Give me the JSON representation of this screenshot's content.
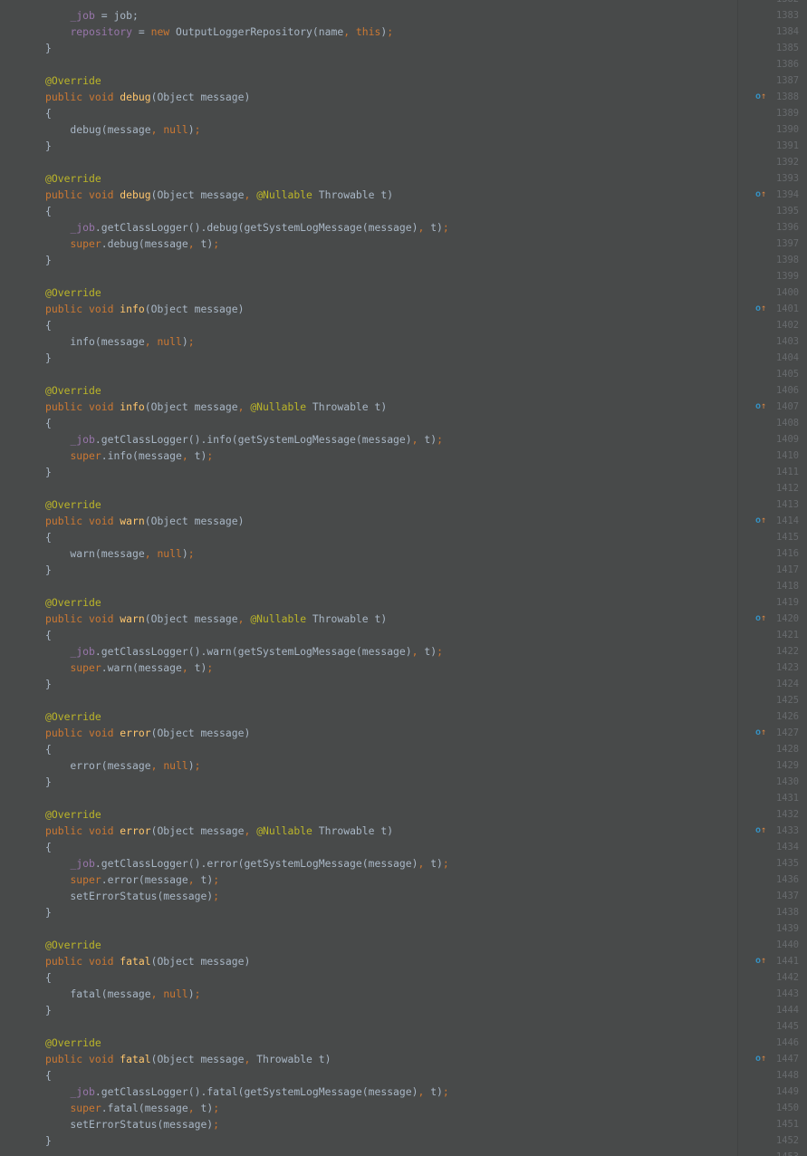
{
  "editor": {
    "first_line": 1382,
    "code_lines": [
      [],
      [
        {
          "t": "    ",
          "c": "pl"
        },
        {
          "t": "_job",
          "c": "fld"
        },
        {
          "t": " = job;",
          "c": "pl"
        }
      ],
      [
        {
          "t": "    ",
          "c": "pl"
        },
        {
          "t": "repository",
          "c": "fld"
        },
        {
          "t": " = ",
          "c": "pl"
        },
        {
          "t": "new",
          "c": "kw"
        },
        {
          "t": " OutputLoggerRepository(name",
          "c": "pl"
        },
        {
          "t": ", ",
          "c": "kw"
        },
        {
          "t": "this",
          "c": "kw"
        },
        {
          "t": ")",
          "c": "pl"
        },
        {
          "t": ";",
          "c": "kw"
        }
      ],
      [
        {
          "t": "}",
          "c": "pl"
        }
      ],
      [],
      [
        {
          "t": "@Override",
          "c": "ann"
        }
      ],
      [
        {
          "t": "public void ",
          "c": "kw"
        },
        {
          "t": "debug",
          "c": "fn"
        },
        {
          "t": "(Object message)",
          "c": "pl"
        }
      ],
      [
        {
          "t": "{",
          "c": "pl"
        }
      ],
      [
        {
          "t": "    debug(message",
          "c": "pl"
        },
        {
          "t": ", ",
          "c": "kw"
        },
        {
          "t": "null",
          "c": "kw"
        },
        {
          "t": ")",
          "c": "pl"
        },
        {
          "t": ";",
          "c": "kw"
        }
      ],
      [
        {
          "t": "}",
          "c": "pl"
        }
      ],
      [],
      [
        {
          "t": "@Override",
          "c": "ann"
        }
      ],
      [
        {
          "t": "public void ",
          "c": "kw"
        },
        {
          "t": "debug",
          "c": "fn"
        },
        {
          "t": "(Object message",
          "c": "pl"
        },
        {
          "t": ", ",
          "c": "kw"
        },
        {
          "t": "@Nullable",
          "c": "ann"
        },
        {
          "t": " Throwable t)",
          "c": "pl"
        }
      ],
      [
        {
          "t": "{",
          "c": "pl"
        }
      ],
      [
        {
          "t": "    ",
          "c": "pl"
        },
        {
          "t": "_job",
          "c": "fld"
        },
        {
          "t": ".getClassLogger().debug(getSystemLogMessage(message)",
          "c": "pl"
        },
        {
          "t": ", ",
          "c": "kw"
        },
        {
          "t": "t)",
          "c": "pl"
        },
        {
          "t": ";",
          "c": "kw"
        }
      ],
      [
        {
          "t": "    ",
          "c": "pl"
        },
        {
          "t": "super",
          "c": "kw"
        },
        {
          "t": ".debug(message",
          "c": "pl"
        },
        {
          "t": ", ",
          "c": "kw"
        },
        {
          "t": "t)",
          "c": "pl"
        },
        {
          "t": ";",
          "c": "kw"
        }
      ],
      [
        {
          "t": "}",
          "c": "pl"
        }
      ],
      [],
      [
        {
          "t": "@Override",
          "c": "ann"
        }
      ],
      [
        {
          "t": "public void ",
          "c": "kw"
        },
        {
          "t": "info",
          "c": "fn"
        },
        {
          "t": "(Object message)",
          "c": "pl"
        }
      ],
      [
        {
          "t": "{",
          "c": "pl"
        }
      ],
      [
        {
          "t": "    info(message",
          "c": "pl"
        },
        {
          "t": ", ",
          "c": "kw"
        },
        {
          "t": "null",
          "c": "kw"
        },
        {
          "t": ")",
          "c": "pl"
        },
        {
          "t": ";",
          "c": "kw"
        }
      ],
      [
        {
          "t": "}",
          "c": "pl"
        }
      ],
      [],
      [
        {
          "t": "@Override",
          "c": "ann"
        }
      ],
      [
        {
          "t": "public void ",
          "c": "kw"
        },
        {
          "t": "info",
          "c": "fn"
        },
        {
          "t": "(Object message",
          "c": "pl"
        },
        {
          "t": ", ",
          "c": "kw"
        },
        {
          "t": "@Nullable",
          "c": "ann"
        },
        {
          "t": " Throwable t)",
          "c": "pl"
        }
      ],
      [
        {
          "t": "{",
          "c": "pl"
        }
      ],
      [
        {
          "t": "    ",
          "c": "pl"
        },
        {
          "t": "_job",
          "c": "fld"
        },
        {
          "t": ".getClassLogger().info(getSystemLogMessage(message)",
          "c": "pl"
        },
        {
          "t": ", ",
          "c": "kw"
        },
        {
          "t": "t)",
          "c": "pl"
        },
        {
          "t": ";",
          "c": "kw"
        }
      ],
      [
        {
          "t": "    ",
          "c": "pl"
        },
        {
          "t": "super",
          "c": "kw"
        },
        {
          "t": ".info(message",
          "c": "pl"
        },
        {
          "t": ", ",
          "c": "kw"
        },
        {
          "t": "t)",
          "c": "pl"
        },
        {
          "t": ";",
          "c": "kw"
        }
      ],
      [
        {
          "t": "}",
          "c": "pl"
        }
      ],
      [],
      [
        {
          "t": "@Override",
          "c": "ann"
        }
      ],
      [
        {
          "t": "public void ",
          "c": "kw"
        },
        {
          "t": "warn",
          "c": "fn"
        },
        {
          "t": "(Object message)",
          "c": "pl"
        }
      ],
      [
        {
          "t": "{",
          "c": "pl"
        }
      ],
      [
        {
          "t": "    warn(message",
          "c": "pl"
        },
        {
          "t": ", ",
          "c": "kw"
        },
        {
          "t": "null",
          "c": "kw"
        },
        {
          "t": ")",
          "c": "pl"
        },
        {
          "t": ";",
          "c": "kw"
        }
      ],
      [
        {
          "t": "}",
          "c": "pl"
        }
      ],
      [],
      [
        {
          "t": "@Override",
          "c": "ann"
        }
      ],
      [
        {
          "t": "public void ",
          "c": "kw"
        },
        {
          "t": "warn",
          "c": "fn"
        },
        {
          "t": "(Object message",
          "c": "pl"
        },
        {
          "t": ", ",
          "c": "kw"
        },
        {
          "t": "@Nullable",
          "c": "ann"
        },
        {
          "t": " Throwable t)",
          "c": "pl"
        }
      ],
      [
        {
          "t": "{",
          "c": "pl"
        }
      ],
      [
        {
          "t": "    ",
          "c": "pl"
        },
        {
          "t": "_job",
          "c": "fld"
        },
        {
          "t": ".getClassLogger().warn(getSystemLogMessage(message)",
          "c": "pl"
        },
        {
          "t": ", ",
          "c": "kw"
        },
        {
          "t": "t)",
          "c": "pl"
        },
        {
          "t": ";",
          "c": "kw"
        }
      ],
      [
        {
          "t": "    ",
          "c": "pl"
        },
        {
          "t": "super",
          "c": "kw"
        },
        {
          "t": ".warn(message",
          "c": "pl"
        },
        {
          "t": ", ",
          "c": "kw"
        },
        {
          "t": "t)",
          "c": "pl"
        },
        {
          "t": ";",
          "c": "kw"
        }
      ],
      [
        {
          "t": "}",
          "c": "pl"
        }
      ],
      [],
      [
        {
          "t": "@Override",
          "c": "ann"
        }
      ],
      [
        {
          "t": "public void ",
          "c": "kw"
        },
        {
          "t": "error",
          "c": "fn"
        },
        {
          "t": "(Object message)",
          "c": "pl"
        }
      ],
      [
        {
          "t": "{",
          "c": "pl"
        }
      ],
      [
        {
          "t": "    error(message",
          "c": "pl"
        },
        {
          "t": ", ",
          "c": "kw"
        },
        {
          "t": "null",
          "c": "kw"
        },
        {
          "t": ")",
          "c": "pl"
        },
        {
          "t": ";",
          "c": "kw"
        }
      ],
      [
        {
          "t": "}",
          "c": "pl"
        }
      ],
      [],
      [
        {
          "t": "@Override",
          "c": "ann"
        }
      ],
      [
        {
          "t": "public void ",
          "c": "kw"
        },
        {
          "t": "error",
          "c": "fn"
        },
        {
          "t": "(Object message",
          "c": "pl"
        },
        {
          "t": ", ",
          "c": "kw"
        },
        {
          "t": "@Nullable",
          "c": "ann"
        },
        {
          "t": " Throwable t)",
          "c": "pl"
        }
      ],
      [
        {
          "t": "{",
          "c": "pl"
        }
      ],
      [
        {
          "t": "    ",
          "c": "pl"
        },
        {
          "t": "_job",
          "c": "fld"
        },
        {
          "t": ".getClassLogger().error(getSystemLogMessage(message)",
          "c": "pl"
        },
        {
          "t": ", ",
          "c": "kw"
        },
        {
          "t": "t)",
          "c": "pl"
        },
        {
          "t": ";",
          "c": "kw"
        }
      ],
      [
        {
          "t": "    ",
          "c": "pl"
        },
        {
          "t": "super",
          "c": "kw"
        },
        {
          "t": ".error(message",
          "c": "pl"
        },
        {
          "t": ", ",
          "c": "kw"
        },
        {
          "t": "t)",
          "c": "pl"
        },
        {
          "t": ";",
          "c": "kw"
        }
      ],
      [
        {
          "t": "    setErrorStatus(message)",
          "c": "pl"
        },
        {
          "t": ";",
          "c": "kw"
        }
      ],
      [
        {
          "t": "}",
          "c": "pl"
        }
      ],
      [],
      [
        {
          "t": "@Override",
          "c": "ann"
        }
      ],
      [
        {
          "t": "public void ",
          "c": "kw"
        },
        {
          "t": "fatal",
          "c": "fn"
        },
        {
          "t": "(Object message)",
          "c": "pl"
        }
      ],
      [
        {
          "t": "{",
          "c": "pl"
        }
      ],
      [
        {
          "t": "    fatal(message",
          "c": "pl"
        },
        {
          "t": ", ",
          "c": "kw"
        },
        {
          "t": "null",
          "c": "kw"
        },
        {
          "t": ")",
          "c": "pl"
        },
        {
          "t": ";",
          "c": "kw"
        }
      ],
      [
        {
          "t": "}",
          "c": "pl"
        }
      ],
      [],
      [
        {
          "t": "@Override",
          "c": "ann"
        }
      ],
      [
        {
          "t": "public void ",
          "c": "kw"
        },
        {
          "t": "fatal",
          "c": "fn"
        },
        {
          "t": "(Object message",
          "c": "pl"
        },
        {
          "t": ", ",
          "c": "kw"
        },
        {
          "t": "Throwable t)",
          "c": "pl"
        }
      ],
      [
        {
          "t": "{",
          "c": "pl"
        }
      ],
      [
        {
          "t": "    ",
          "c": "pl"
        },
        {
          "t": "_job",
          "c": "fld"
        },
        {
          "t": ".getClassLogger().fatal(getSystemLogMessage(message)",
          "c": "pl"
        },
        {
          "t": ", ",
          "c": "kw"
        },
        {
          "t": "t)",
          "c": "pl"
        },
        {
          "t": ";",
          "c": "kw"
        }
      ],
      [
        {
          "t": "    ",
          "c": "pl"
        },
        {
          "t": "super",
          "c": "kw"
        },
        {
          "t": ".fatal(message",
          "c": "pl"
        },
        {
          "t": ", ",
          "c": "kw"
        },
        {
          "t": "t)",
          "c": "pl"
        },
        {
          "t": ";",
          "c": "kw"
        }
      ],
      [
        {
          "t": "    setErrorStatus(message)",
          "c": "pl"
        },
        {
          "t": ";",
          "c": "kw"
        }
      ],
      [
        {
          "t": "}",
          "c": "pl"
        }
      ],
      []
    ],
    "override_marker_lines": [
      1388,
      1394,
      1401,
      1407,
      1414,
      1420,
      1427,
      1433,
      1441,
      1447
    ],
    "override_marker_icon": "override-method-icon"
  },
  "colors": {
    "background": "#484a4a",
    "gutter": "#474949",
    "keyword": "#cc7832",
    "annotation": "#bbb529",
    "field": "#9876aa",
    "method_declaration": "#ffc66d",
    "plain_text": "#a9b7c6",
    "line_number": "#676a6d",
    "override_marker": "#3592c4"
  }
}
